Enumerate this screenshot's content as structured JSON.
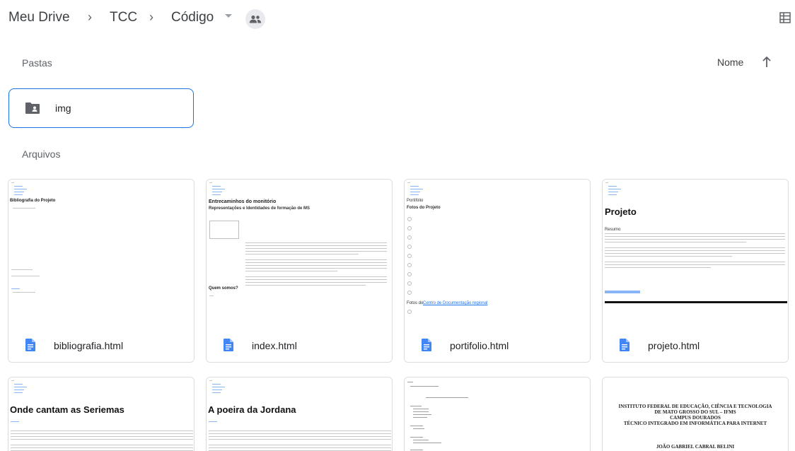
{
  "breadcrumb": {
    "root": "Meu Drive",
    "level1": "TCC",
    "current": "Código"
  },
  "icons": {
    "shared": "people-icon",
    "view": "grid-view-icon",
    "sort": "arrow-up-icon",
    "folder": "shared-folder-icon",
    "file": "google-doc-icon"
  },
  "colors": {
    "accent": "#1a73e8",
    "doc_icon": "#4285f4"
  },
  "sections": {
    "folders_label": "Pastas",
    "files_label": "Arquivos",
    "sort_label": "Nome"
  },
  "folders": [
    {
      "name": "img"
    }
  ],
  "files": [
    {
      "name": "bibliografia.html"
    },
    {
      "name": "index.html"
    },
    {
      "name": "portifolio.html"
    },
    {
      "name": "projeto.html"
    }
  ],
  "previews": {
    "bibliografia_heading": "Bibliografia do Projeto",
    "index_title": "Entrecaminhos do monitório",
    "index_subtitle": "Representações e Identidades de formação de MS",
    "index_bottom": "Quem somos?",
    "portifolio_heading": "Portifólio",
    "portifolio_sub": "Fotos do Projeto",
    "portifolio_caption": "Fotos do",
    "portifolio_link": "Centro de Documentação regional",
    "projeto_title": "Projeto",
    "projeto_resumo": "Resumo",
    "seriemas_title": "Onde cantam as Seriemas",
    "jordana_title": "A poeira da Jordana",
    "doc_line1": "INSTITUTO FEDERAL DE EDUCAÇÃO, CIÊNCIA E TECNOLOGIA",
    "doc_line2": "DE MATO GROSSO DO SUL – IFMS",
    "doc_line3": "CAMPUS DOURADOS",
    "doc_line4": "TÉCNICO INTEGRADO EM INFORMÁTICA PARA INTERNET",
    "doc_author": "JOÃO GABRIEL CABRAL BELINI"
  }
}
